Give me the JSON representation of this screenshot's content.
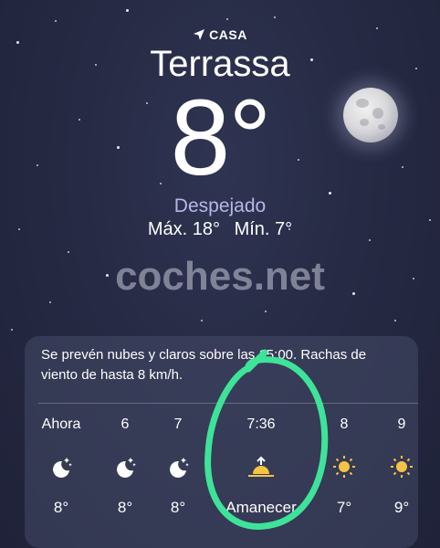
{
  "location": {
    "label": "CASA",
    "icon": "location-arrow-icon"
  },
  "city": "Terrassa",
  "current": {
    "temperature": "8°",
    "condition": "Despejado",
    "high": "Máx. 18°",
    "low": "Mín. 7°"
  },
  "watermark": "coches.net",
  "forecast": {
    "summary": "Se prevén nubes y claros sobre las 15:00. Rachas de viento de hasta 8 km/h.",
    "hours": [
      {
        "time": "Ahora",
        "icon": "moon-stars-icon",
        "value": "8°"
      },
      {
        "time": "6",
        "icon": "moon-stars-icon",
        "value": "8°"
      },
      {
        "time": "7",
        "icon": "moon-stars-icon",
        "value": "8°"
      },
      {
        "time": "7:36",
        "icon": "sunrise-icon",
        "value": "Amanecer"
      },
      {
        "time": "8",
        "icon": "sun-icon",
        "value": "7°"
      },
      {
        "time": "9",
        "icon": "sun-icon",
        "value": "9°"
      }
    ]
  },
  "colors": {
    "condition": "#b9b6e6",
    "annotation": "#3ee39a",
    "sun": "#f6c443"
  }
}
